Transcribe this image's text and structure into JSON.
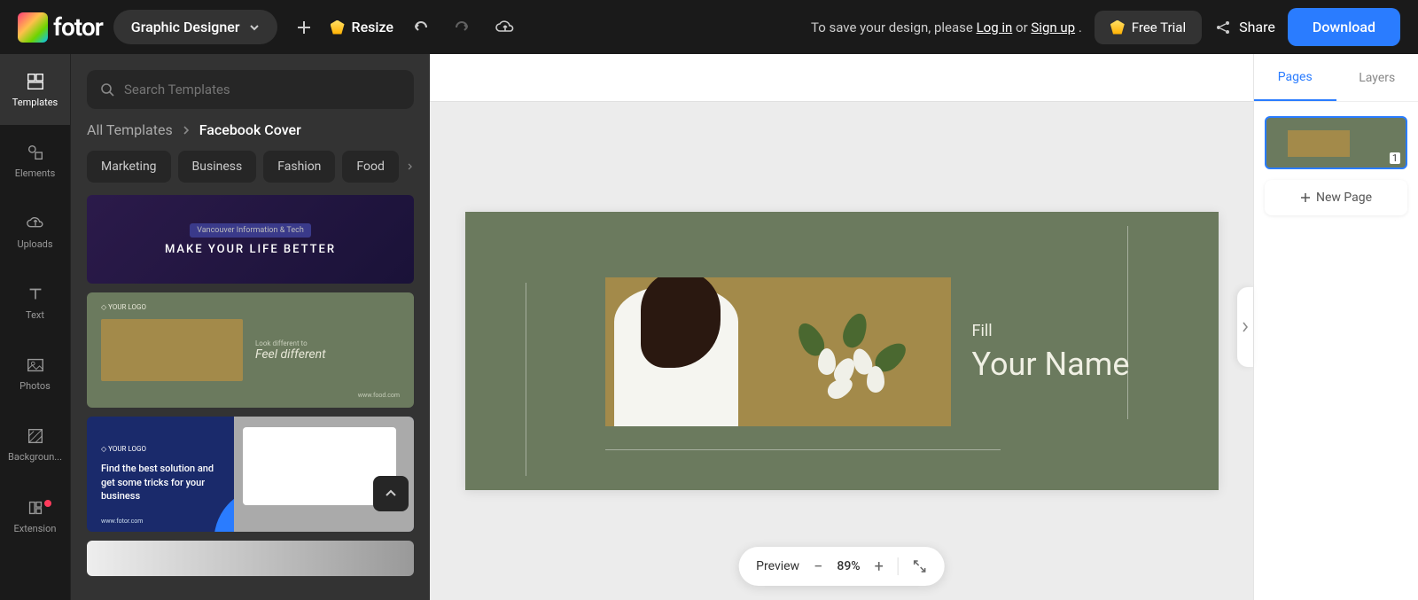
{
  "brand": "fotor",
  "modeDropdown": "Graphic Designer",
  "resizeLabel": "Resize",
  "saveMessage": {
    "prefix": "To save your design, please  ",
    "login": "Log in",
    "or": "or",
    "signup": "Sign up",
    "suffix": " ."
  },
  "freeTrialLabel": "Free  Trial",
  "shareLabel": "Share",
  "downloadLabel": "Download",
  "rail": [
    {
      "label": "Templates"
    },
    {
      "label": "Elements"
    },
    {
      "label": "Uploads"
    },
    {
      "label": "Text"
    },
    {
      "label": "Photos"
    },
    {
      "label": "Backgroun..."
    },
    {
      "label": "Extension"
    }
  ],
  "searchPlaceholder": "Search Templates",
  "breadcrumb": {
    "root": "All Templates",
    "current": "Facebook Cover"
  },
  "filters": [
    "Marketing",
    "Business",
    "Fashion",
    "Food"
  ],
  "templates": {
    "t1": {
      "tag": "Vancouver Information & Tech",
      "headline": "MAKE YOUR LIFE BETTER"
    },
    "t2": {
      "logo": "◇ YOUR LOGO",
      "small": "Look different to",
      "big": "Feel different",
      "url": "www.food.com"
    },
    "t3": {
      "logo": "◇ YOUR LOGO",
      "msg": "Find the best solution and get  some tricks for your business",
      "url": "www.fotor.com"
    }
  },
  "canvas": {
    "smallText": "Fill",
    "bigText": "Your Name"
  },
  "pagesPanel": {
    "tabPages": "Pages",
    "tabLayers": "Layers",
    "pageNumber": "1",
    "newPage": "New Page"
  },
  "zoom": {
    "preview": "Preview",
    "value": "89%"
  }
}
